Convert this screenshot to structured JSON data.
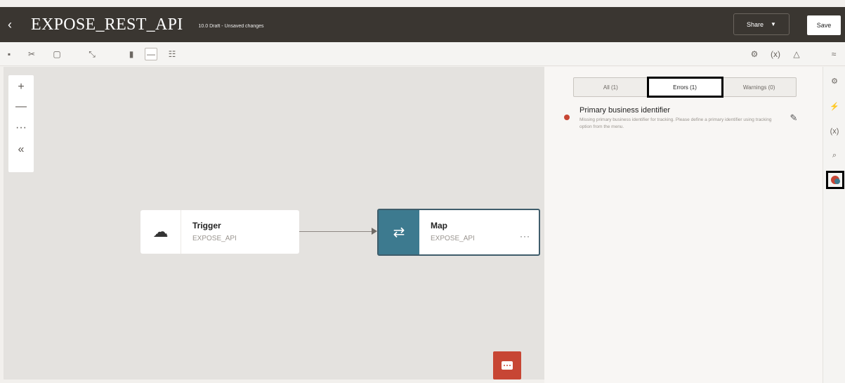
{
  "header": {
    "back_icon": "chevron-left-icon",
    "title": "EXPOSE_REST_API",
    "subtitle": "10.0 Draft - Unsaved changes",
    "share_label": "Share",
    "save_label": "Save"
  },
  "toolbar": {
    "left_icons": [
      "save-icon",
      "cut-icon",
      "copy-icon",
      "collapse-icon",
      "layout-vertical-icon",
      "layout-horizontal-icon",
      "layout-pseudo-icon"
    ],
    "right_icons": [
      "settings-icon",
      "variables-icon",
      "warning-icon",
      "expand-icon"
    ]
  },
  "canvas": {
    "zoom_controls": [
      "+",
      "—",
      "···",
      "«"
    ],
    "nodes": [
      {
        "title": "Trigger",
        "subtitle": "EXPOSE_API",
        "icon": "trigger-cloud-icon"
      },
      {
        "title": "Map",
        "subtitle": "EXPOSE_API",
        "icon": "map-arrows-icon",
        "menu": "···"
      }
    ],
    "chat_icon": "chat-icon",
    "colors": {
      "map_accent": "#3d7a8f",
      "chat_bg": "#c74634"
    }
  },
  "panel": {
    "tabs": [
      {
        "label": "All (1)",
        "active": false
      },
      {
        "label": "Errors (1)",
        "active": true
      },
      {
        "label": "Warnings (0)",
        "active": false
      }
    ],
    "errors": [
      {
        "title": "Primary business identifier",
        "description": "Missing primary business identifier for tracking. Please define a primary identifier using tracking option from the menu.",
        "status_color": "#c74634"
      }
    ]
  },
  "rail": {
    "icons": [
      "integration-icon",
      "actions-icon",
      "variables-icon",
      "search-icon",
      "errors-icon"
    ]
  }
}
